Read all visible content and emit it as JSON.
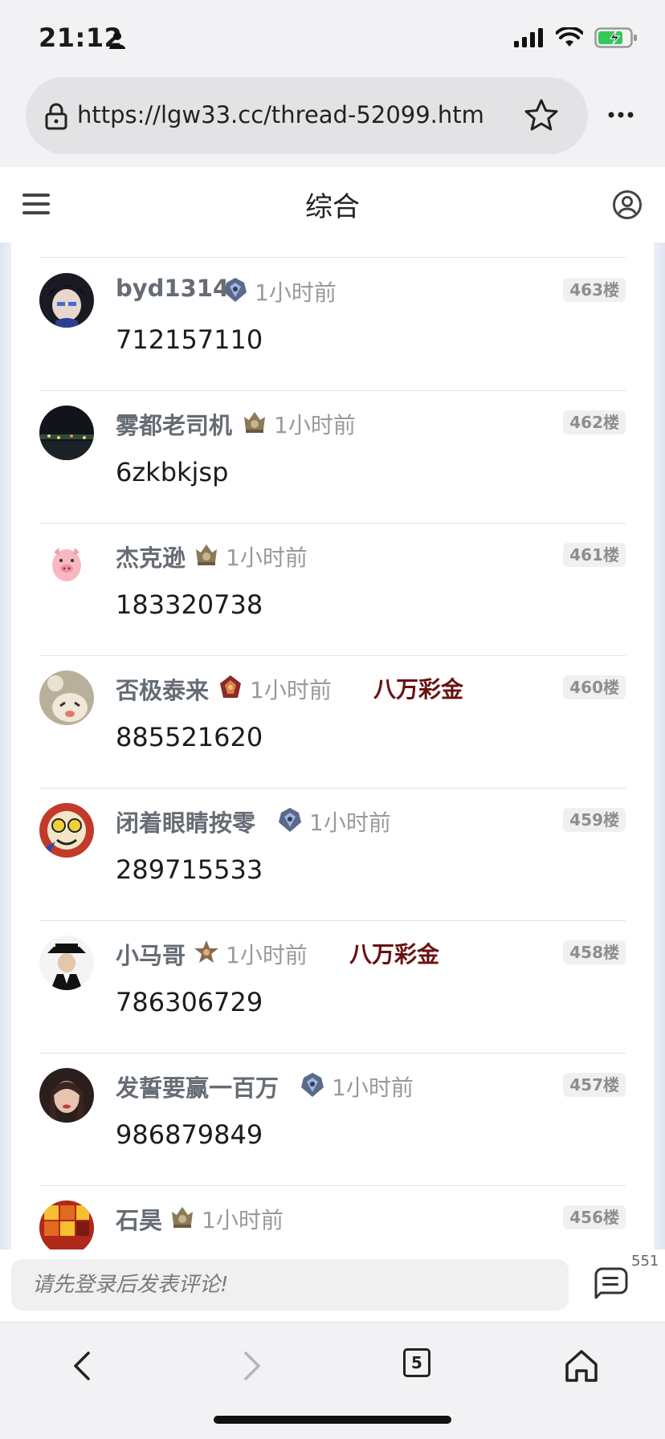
{
  "status_bar": {
    "time": "21:12"
  },
  "browser": {
    "url": "https://lgw33.cc/thread-52099.htm",
    "tab_count": "5"
  },
  "header": {
    "title": "综合"
  },
  "posts": [
    {
      "username": "byd1314",
      "time": "1小时前",
      "tag": "",
      "floor": "463楼",
      "content": "712157110"
    },
    {
      "username": "雾都老司机",
      "time": "1小时前",
      "tag": "",
      "floor": "462楼",
      "content": "6zkbkjsp"
    },
    {
      "username": "杰克逊",
      "time": "1小时前",
      "tag": "",
      "floor": "461楼",
      "content": "183320738"
    },
    {
      "username": "否极泰来",
      "time": "1小时前",
      "tag": "八万彩金",
      "floor": "460楼",
      "content": "885521620"
    },
    {
      "username": "闭着眼睛按零",
      "time": "1小时前",
      "tag": "",
      "floor": "459楼",
      "content": "289715533"
    },
    {
      "username": "小马哥",
      "time": "1小时前",
      "tag": "八万彩金",
      "floor": "458楼",
      "content": "786306729"
    },
    {
      "username": "发誓要赢一百万",
      "time": "1小时前",
      "tag": "",
      "floor": "457楼",
      "content": "986879849"
    },
    {
      "username": "石昊",
      "time": "1小时前",
      "tag": "",
      "floor": "456楼",
      "content": ""
    }
  ],
  "comment_bar": {
    "placeholder": "请先登录后发表评论!",
    "count": "551"
  },
  "colors": {
    "tag": "#6a1010",
    "username": "#666c74",
    "time": "#9a9a9a",
    "floor_bg": "#f0f0f0"
  }
}
